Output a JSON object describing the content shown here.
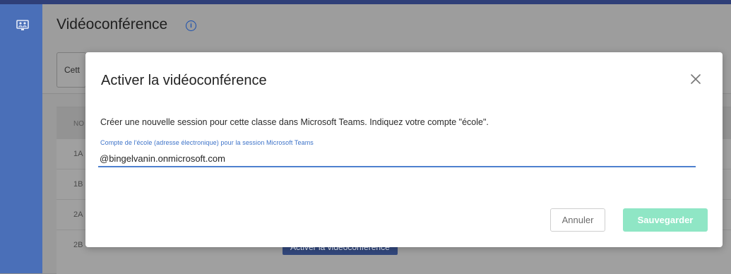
{
  "header": {
    "title": "Vidéoconférence",
    "filter_partial": "Cett"
  },
  "table": {
    "header_partial": "NO",
    "rows": [
      {
        "name": "1A"
      },
      {
        "name": "1B"
      },
      {
        "name": "2A"
      },
      {
        "name": "2B"
      }
    ],
    "row_action_label": "Activer la vidéoconférence"
  },
  "modal": {
    "title": "Activer la vidéoconférence",
    "body": "Créer une nouvelle session pour cette classe dans Microsoft Teams. Indiquez votre compte \"école\".",
    "field_label": "Compte de l'école (adresse électronique) pour la session Microsoft Teams",
    "field_value": "@bingelvanin.onmicrosoft.com",
    "cancel_label": "Annuler",
    "save_label": "Sauvegarder"
  },
  "colors": {
    "sidebar": "#4a6fb8",
    "accent": "#3c72c8",
    "save_button": "#8fe6c5",
    "row_button": "#32477c"
  }
}
